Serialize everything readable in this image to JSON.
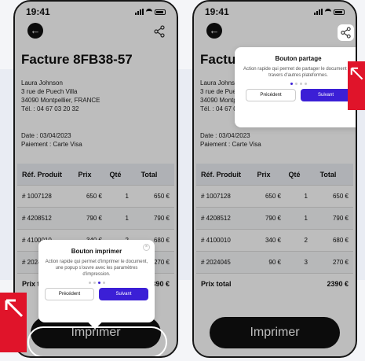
{
  "status": {
    "time": "19:41"
  },
  "invoice": {
    "title": "Facture 8FB38-57",
    "name": "Laura Johnson",
    "street": "3 rue de Puech Villa",
    "city": "34090 Montpellier, FRANCE",
    "phone": "Tél. : 04 67 03 20 32",
    "date": "Date : 03/04/2023",
    "payment": "Paiement : Carte Visa",
    "headers": [
      "Réf. Produit",
      "Prix",
      "Qté",
      "Total"
    ],
    "rows": [
      [
        "# 1007128",
        "650 €",
        "1",
        "650 €"
      ],
      [
        "# 4208512",
        "790 €",
        "1",
        "790 €"
      ],
      [
        "# 4100010",
        "340 €",
        "2",
        "680 €"
      ],
      [
        "# 2024045",
        "90 €",
        "3",
        "270 €"
      ]
    ],
    "total_label": "Prix total",
    "total_value": "2390 €",
    "cta": "Imprimer"
  },
  "popup_print": {
    "title": "Bouton imprimer",
    "text": "Action rapide qui permet d'imprimer le document, une popup s'ouvre avec les paramètres d'impression.",
    "prev": "Précédent",
    "next": "Suivant"
  },
  "popup_share": {
    "title": "Bouton partage",
    "text": "Action rapide qui permet de partager le document au travers d'autres plateformes.",
    "prev": "Précédent",
    "next": "Suivant"
  },
  "colors": {
    "accent": "#3b1fd6",
    "marker": "#e0142a"
  }
}
